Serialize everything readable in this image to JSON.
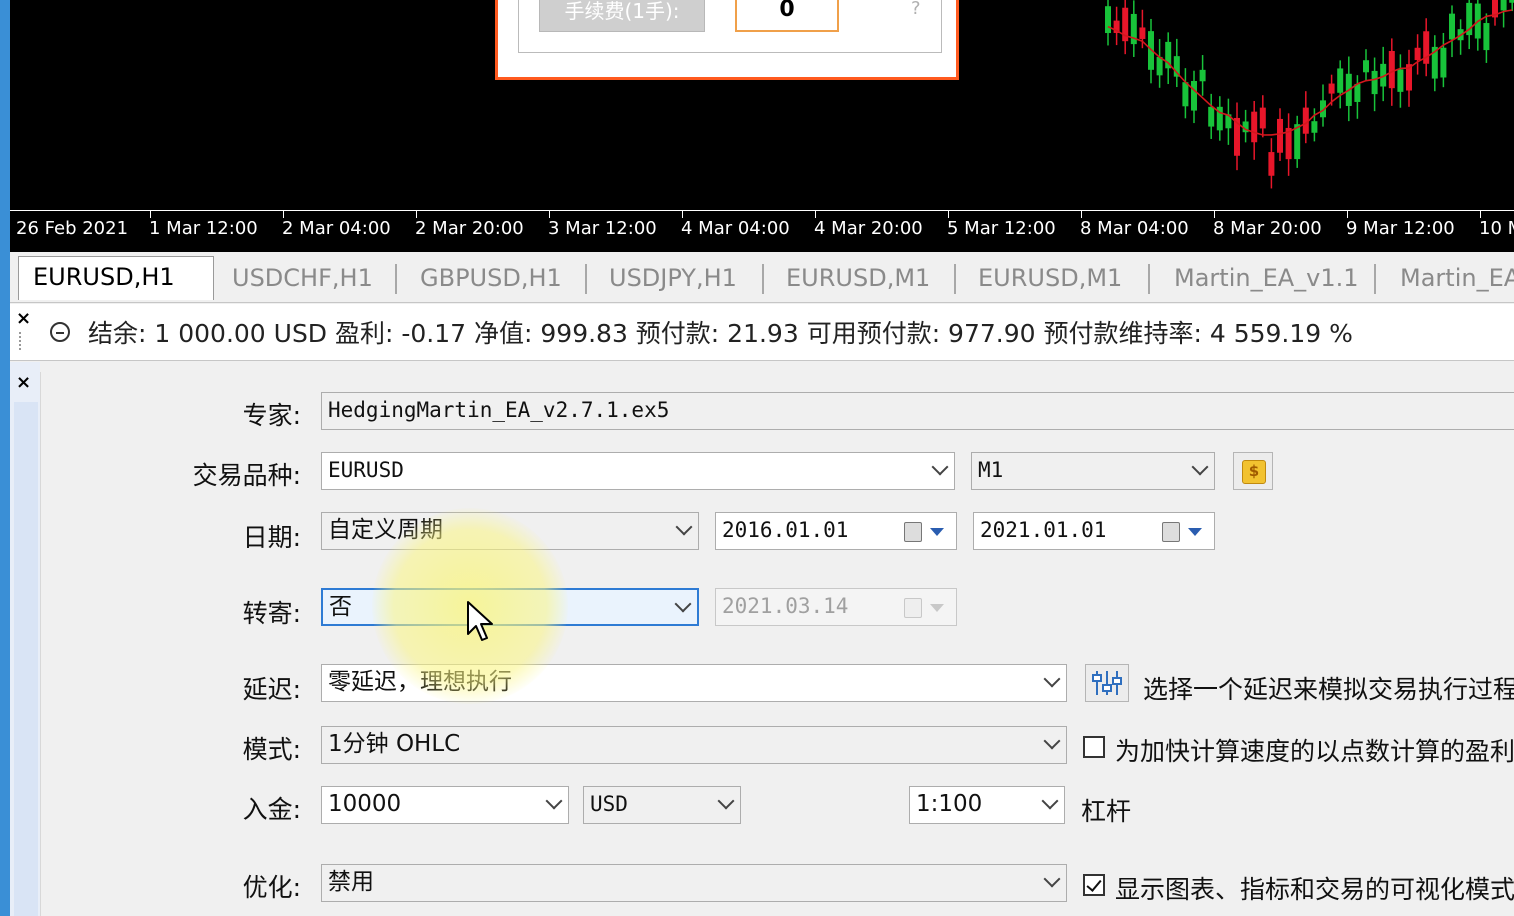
{
  "chart": {
    "time_labels": [
      "26 Feb 2021",
      "1 Mar 12:00",
      "2 Mar 04:00",
      "2 Mar 20:00",
      "3 Mar 12:00",
      "4 Mar 04:00",
      "4 Mar 20:00",
      "5 Mar 12:00",
      "8 Mar 04:00",
      "8 Mar 20:00",
      "9 Mar 12:00",
      "10 M"
    ],
    "bull_color": "#e8162a",
    "bear_color": "#18c33a",
    "ma_color": "#d4171d"
  },
  "dialog": {
    "fee_label": "手续费(1手):",
    "fee_value": "0",
    "help": "?"
  },
  "tabs": [
    "EURUSD,H1",
    "USDCHF,H1",
    "GBPUSD,H1",
    "USDJPY,H1",
    "EURUSD,M1",
    "EURUSD,M1",
    "Martin_EA_v1.1",
    "Martin_EA"
  ],
  "account": {
    "summary": "结余: 1 000.00 USD  盈利: -0.17  净值: 999.83  预付款: 21.93  可用预付款: 977.90  预付款维持率: 4 559.19 %"
  },
  "close_symbol": "×",
  "tester": {
    "expert_label": "专家:",
    "expert_value": "HedgingMartin_EA_v2.7.1.ex5",
    "symbol_label": "交易品种:",
    "symbol_value": "EURUSD",
    "timeframe_value": "M1",
    "date_label": "日期:",
    "date_mode": "自定义周期",
    "date_from": "2016.01.01",
    "date_to": "2021.01.01",
    "forward_label": "转寄:",
    "forward_value": "否",
    "forward_date": "2021.03.14",
    "delay_label": "延迟:",
    "delay_value": "零延迟，理想执行",
    "delay_hint": "选择一个延迟来模拟交易执行过程",
    "mode_label": "模式:",
    "mode_value": "1分钟 OHLC",
    "mode_hint": "为加快计算速度的以点数计算的盈利",
    "deposit_label": "入金:",
    "deposit_value": "10000",
    "currency_value": "USD",
    "leverage_value": "1:100",
    "leverage_label": "杠杆",
    "optimization_label": "优化:",
    "optimization_value": "禁用",
    "visual_hint": "显示图表、指标和交易的可视化模式",
    "coin_glyph": "$"
  }
}
